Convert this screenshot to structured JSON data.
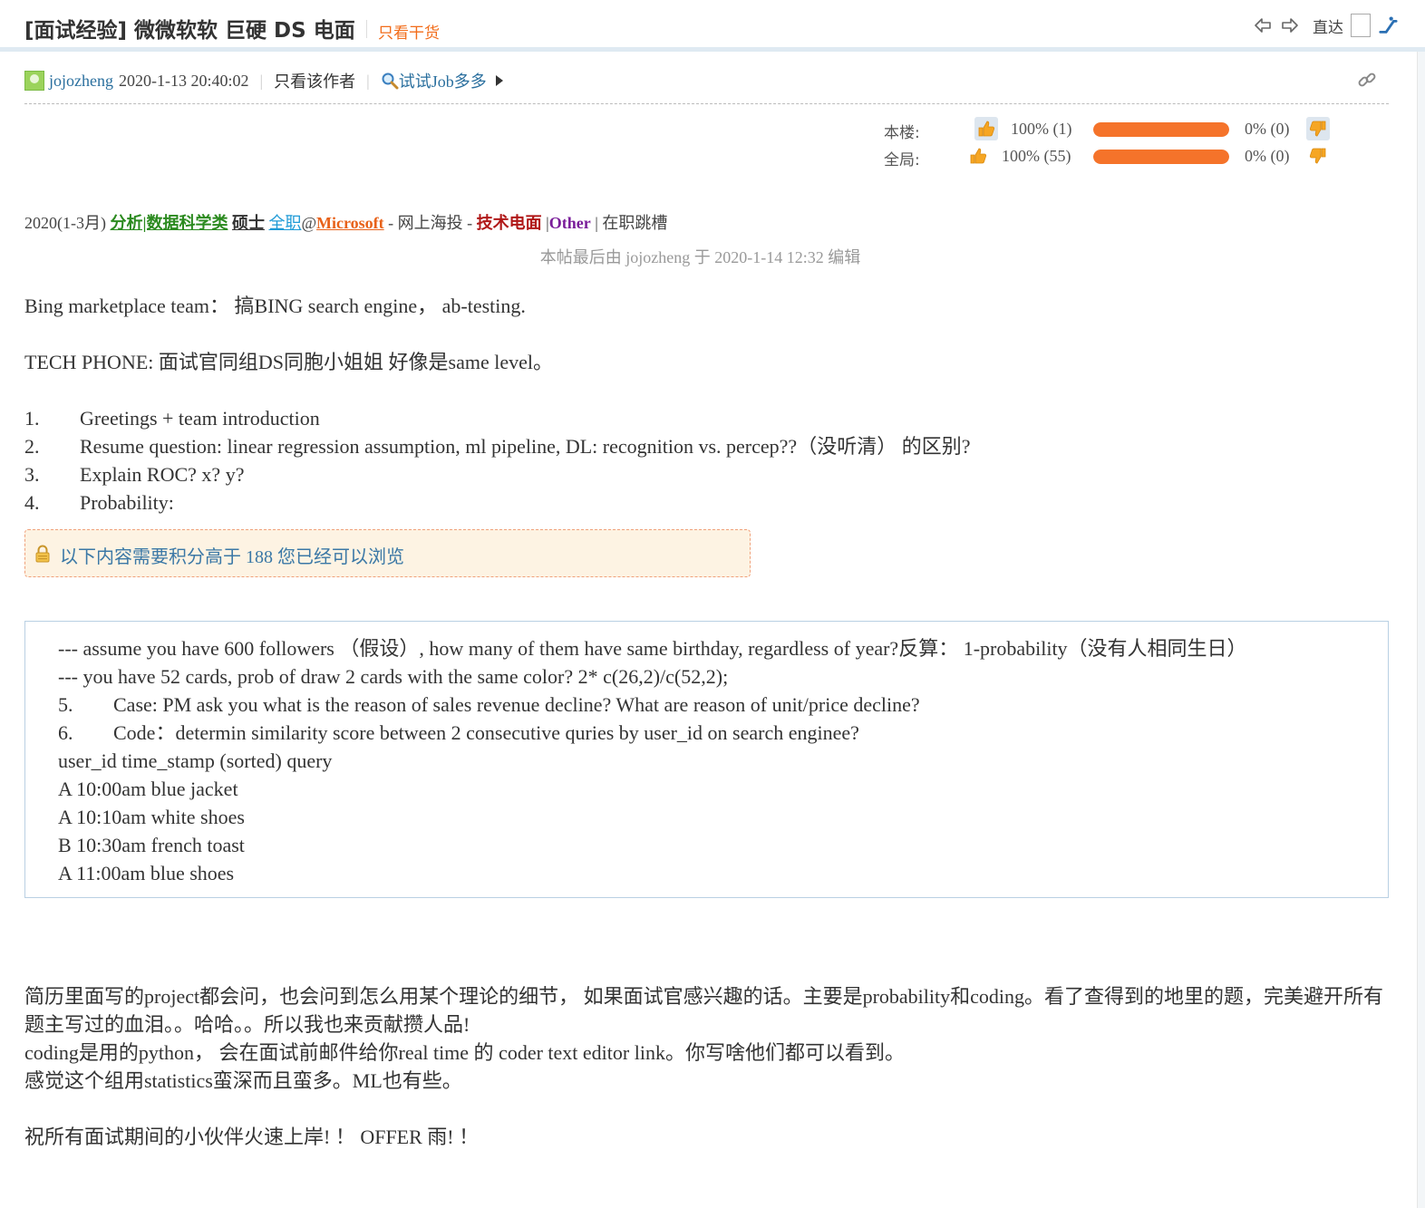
{
  "header": {
    "title": "[面试经验] 微微软软 巨硬 DS 电面",
    "only_dry_goods": "只看干货",
    "jump_label": "直达"
  },
  "meta": {
    "author": "jojozheng",
    "date": "2020-1-13 20:40:02",
    "only_author": "只看该作者",
    "search_job": "试试Job多多"
  },
  "rating": {
    "this_floor": {
      "label": "本楼:",
      "up": "100% (1)",
      "down": "0% (0)",
      "up_fraction": 1.0
    },
    "overall": {
      "label": "全局:",
      "up": "100% (55)",
      "down": "0% (0)",
      "up_fraction": 1.0
    }
  },
  "tags": {
    "period": "2020(1-3月)",
    "field": "分析|数据科学类",
    "degree": "硕士",
    "job_type": "全职",
    "at": "@",
    "company": "Microsoft",
    "channel": "- 网上海投 -",
    "stage": "技术电面",
    "sep1": "|",
    "result": "Other",
    "status": "| 在职跳槽"
  },
  "edited_note": "本帖最后由 jojozheng 于 2020-1-14 12:32 编辑",
  "body": {
    "line1": "Bing marketplace team： 搞BING search engine， ab-testing.",
    "line2": "TECH PHONE: 面试官同组DS同胞小姐姐 好像是same level。",
    "list": [
      {
        "num": "1.",
        "text": "Greetings + team introduction"
      },
      {
        "num": "2.",
        "text": "Resume question: linear regression assumption, ml pipeline, DL: recognition vs. percep??（没听清） 的区别?"
      },
      {
        "num": "3.",
        "text": "Explain ROC? x? y?"
      },
      {
        "num": "4.",
        "text": "Probability:"
      }
    ]
  },
  "locked_notice": "以下内容需要积分高于 188 您已经可以浏览",
  "hidden_content": {
    "line1": "--- assume you have 600 followers （假设）, how many of them have same birthday, regardless of year?反算： 1-probability（没有人相同生日）",
    "line2": "--- you have 52 cards, prob of draw 2 cards with the same color?  2* c(26,2)/c(52,2);",
    "items": [
      {
        "num": "5.",
        "text": "Case: PM ask you what is the reason of sales revenue decline? What are reason of unit/price decline?"
      },
      {
        "num": "6.",
        "text": "Code：determin similarity score between 2 consecutive quries by user_id on search enginee?"
      }
    ],
    "table_header": "user_id time_stamp (sorted) query",
    "rows": [
      "A 10:00am blue jacket",
      "A 10:10am white shoes",
      "B 10:30am french toast",
      "A 11:00am blue shoes"
    ]
  },
  "footer": {
    "p1": "简历里面写的project都会问，也会问到怎么用某个理论的细节， 如果面试官感兴趣的话。主要是probability和coding。看了查得到的地里的题，完美避开所有题主写过的血泪。。哈哈。。所以我也来贡献攒人品!",
    "p2": "coding是用的python， 会在面试前邮件给你real time 的 coder text editor link。你写啥他们都可以看到。",
    "p3": "感觉这个组用statistics蛮深而且蛮多。ML也有些。",
    "p4": "祝所有面试期间的小伙伴火速上岸! ！ OFFER 雨! ！"
  },
  "colors": {
    "accent_orange": "#f26c1a",
    "link_blue": "#2a6f9e",
    "bar_fill": "#f5732a",
    "tag_green": "#2b8a1f",
    "tag_red": "#b01818",
    "tag_purple": "#7a1e9a"
  },
  "icons": [
    "prev-arrow-icon",
    "next-arrow-icon",
    "escalator-icon",
    "search-icon",
    "link-icon",
    "thumbs-up-icon",
    "thumbs-down-icon",
    "lock-icon"
  ]
}
